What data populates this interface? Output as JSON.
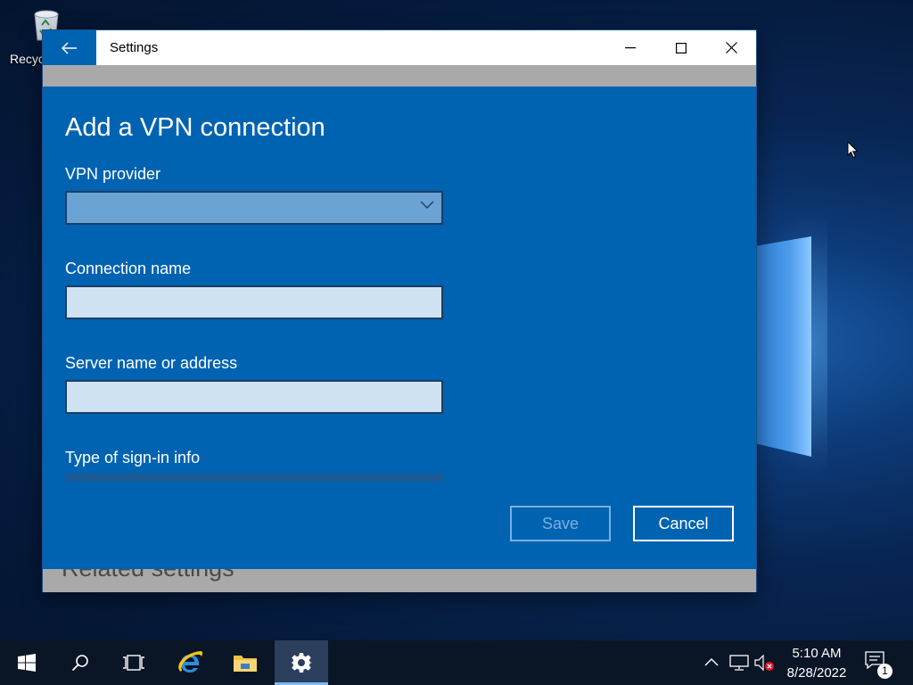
{
  "desktop": {
    "recycle_bin_label": "Recyc",
    "colors": {
      "wallpaper_dark": "#051a3c",
      "wallpaper_glow": "#4c9cec"
    }
  },
  "window": {
    "title": "Settings",
    "back_icon": "arrow-left-icon",
    "controls": {
      "minimize": "minimize-icon",
      "maximize": "maximize-icon",
      "close": "close-icon"
    },
    "background_heading": "Related settings",
    "colors": {
      "accent": "#0063b1",
      "titlebar": "#ffffff"
    }
  },
  "dialog": {
    "title": "Add a VPN connection",
    "vpn_provider": {
      "label": "VPN provider",
      "value": "",
      "icon": "chevron-down-icon"
    },
    "connection_name": {
      "label": "Connection name",
      "value": ""
    },
    "server": {
      "label": "Server name or address",
      "value": ""
    },
    "signin_type": {
      "label": "Type of sign-in info"
    },
    "save_label": "Save",
    "save_enabled": false,
    "cancel_label": "Cancel"
  },
  "taskbar": {
    "buttons": [
      {
        "name": "start",
        "icon": "windows-logo-icon"
      },
      {
        "name": "search",
        "icon": "search-icon"
      },
      {
        "name": "task-view",
        "icon": "task-view-icon"
      },
      {
        "name": "internet-explorer",
        "icon": "ie-icon"
      },
      {
        "name": "file-explorer",
        "icon": "folder-icon"
      },
      {
        "name": "settings",
        "icon": "gear-icon",
        "active": true
      }
    ],
    "tray": {
      "time": "5:10 AM",
      "date": "8/28/2022",
      "notification_count": "1",
      "icons": [
        "chevron-up-icon",
        "network-icon",
        "volume-muted-icon"
      ]
    },
    "colors": {
      "background": "#0a1526",
      "active": "#2b3f5c"
    }
  }
}
